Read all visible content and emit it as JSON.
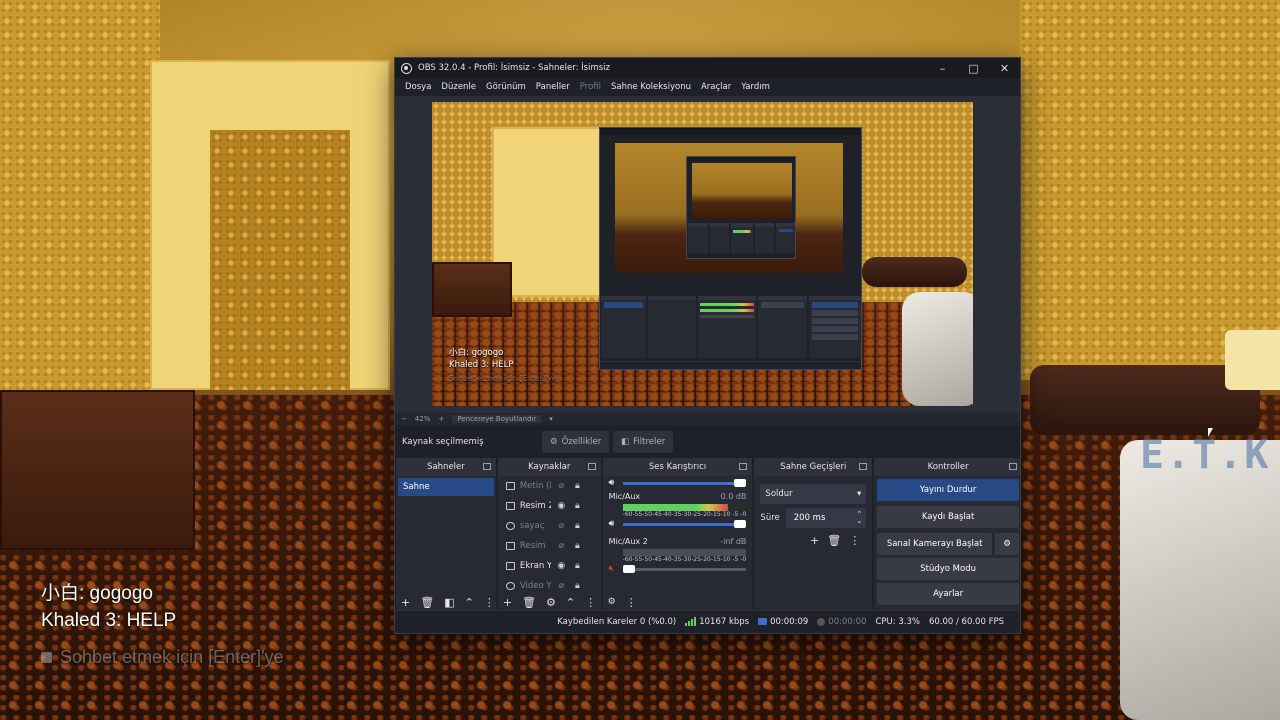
{
  "window": {
    "title": "OBS 32.0.4 - Profil: İsimsiz - Sahneler: İsimsiz",
    "controls": [
      "–",
      "□",
      "✕"
    ]
  },
  "menu": [
    {
      "label": "Dosya",
      "enabled": true
    },
    {
      "label": "Düzenle",
      "enabled": true
    },
    {
      "label": "Görünüm",
      "enabled": true
    },
    {
      "label": "Paneller",
      "enabled": true
    },
    {
      "label": "Profil",
      "enabled": false
    },
    {
      "label": "Sahne Koleksiyonu",
      "enabled": true
    },
    {
      "label": "Araçlar",
      "enabled": true
    },
    {
      "label": "Yardım",
      "enabled": true
    }
  ],
  "game_chat": {
    "line1": "小白: gogogo",
    "line2": "Khaled 3: HELP",
    "hint": "Sohbet etmek için [Enter]'ye"
  },
  "game_logo": "E.T.K",
  "preview_chat": {
    "line1": "小白: gogogo",
    "line2": "Khaled 3: HELP",
    "hint": "Sohbet etmek için [Enter]'ye"
  },
  "zoom": {
    "minus": "−",
    "level": "42%",
    "plus": "+",
    "fit_label": "Pencereye Boyutlandır"
  },
  "source_toolbar": {
    "no_selection": "Kaynak seçilmemiş",
    "properties": "Özellikler",
    "filters": "Filtreler"
  },
  "docks": {
    "scenes": {
      "title": "Sahneler",
      "items": [
        "Sahne"
      ]
    },
    "sources": {
      "title": "Kaynaklar",
      "items": [
        {
          "label": "Metin (F",
          "visible": false,
          "locked": true
        },
        {
          "label": "Resim 2",
          "visible": true,
          "locked": true
        },
        {
          "label": "sayaç",
          "visible": false,
          "locked": true
        },
        {
          "label": "Resim",
          "visible": false,
          "locked": true
        },
        {
          "label": "Ekran Ya",
          "visible": true,
          "locked": true
        },
        {
          "label": "Video Ya",
          "visible": false,
          "locked": true
        }
      ]
    },
    "mixer": {
      "title": "Ses Karıştırıcı",
      "channels": [
        {
          "name": "Mic/Aux",
          "db": "0.0 dB",
          "level": 0.85,
          "muted": false
        },
        {
          "name": "Mic/Aux 2",
          "db": "-inf dB",
          "level": 0.0,
          "muted": true
        }
      ],
      "ticks": "-60-55-50-45-40-35-30-25-20-15-10 -5 -0"
    },
    "transitions": {
      "title": "Sahne Geçişleri",
      "selected": "Soldur",
      "duration_label": "Süre",
      "duration_value": "200 ms"
    },
    "controls": {
      "title": "Kontroller",
      "stop_stream": "Yayını Durdur",
      "start_record": "Kaydı Başlat",
      "virtual_cam": "Sanal Kamerayı Başlat",
      "studio_mode": "Stüdyo Modu",
      "settings": "Ayarlar"
    }
  },
  "status": {
    "dropped": "Kaybedilen Kareler 0 (%0.0)",
    "bitrate": "10167 kbps",
    "stream_time": "00:00:09",
    "record_time": "00:00:00",
    "cpu": "CPU: 3.3%",
    "fps": "60.00 / 60.00 FPS"
  },
  "colors": {
    "accent": "#274a86",
    "meter_green": "#5fd35f",
    "muted_red": "#d64545"
  }
}
